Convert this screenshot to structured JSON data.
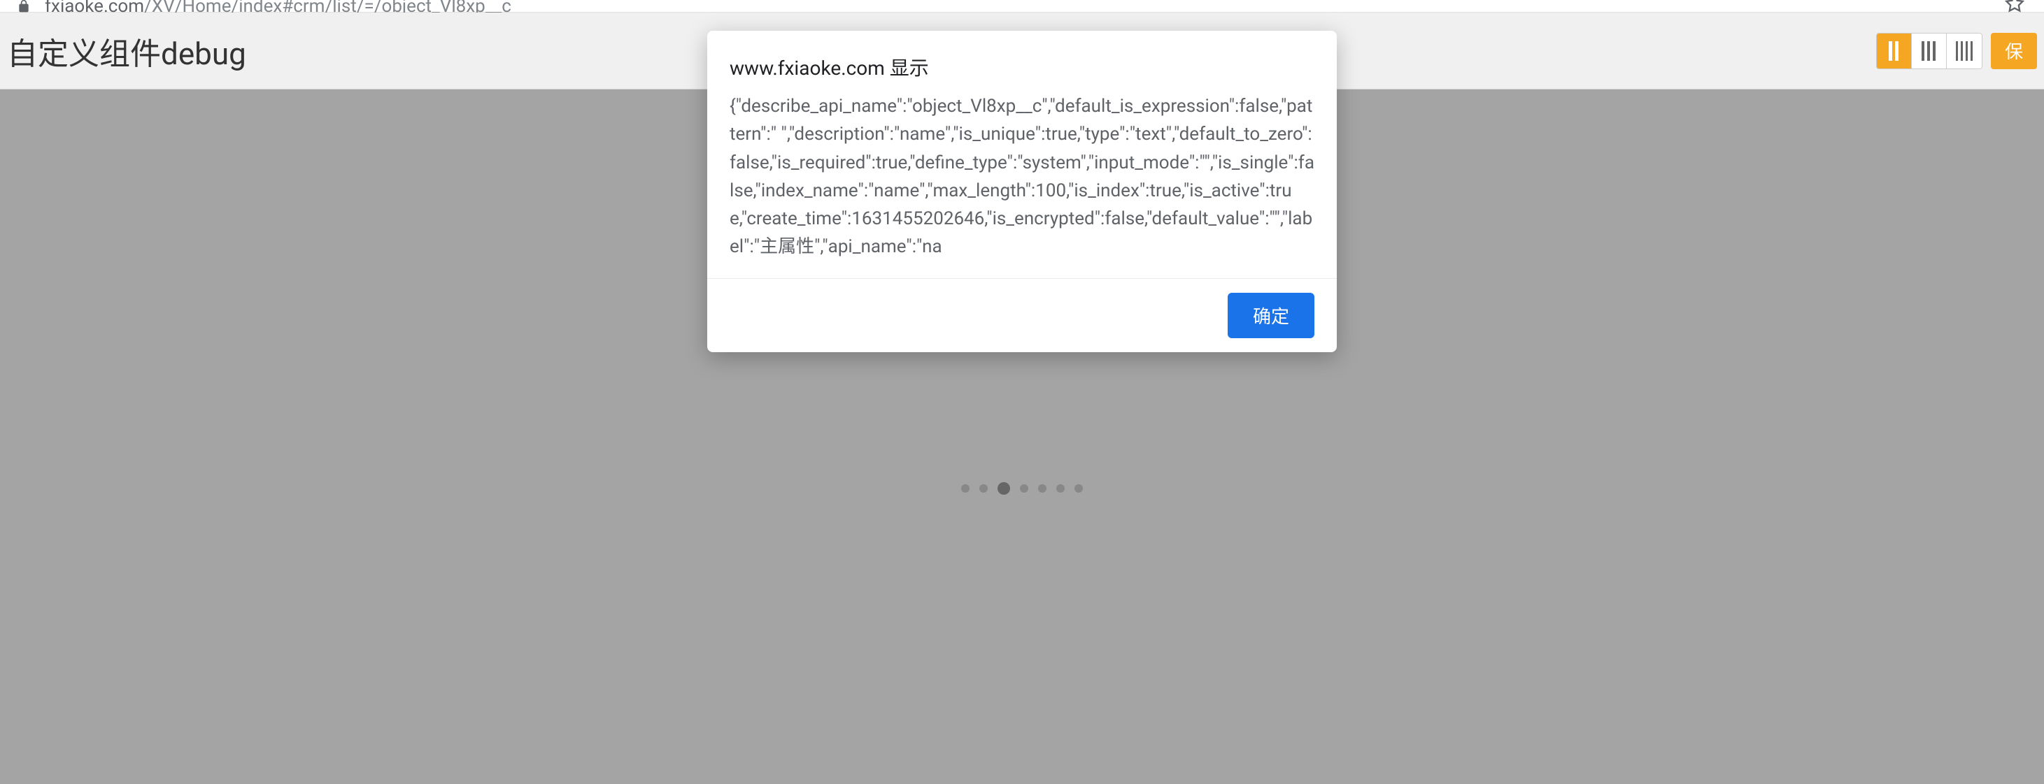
{
  "browser": {
    "url_domain": "fxiaoke.com",
    "url_path": "/XV/Home/index#crm/list/=/object_Vl8xp__c"
  },
  "header": {
    "title": "自定义组件debug",
    "save_label": "保"
  },
  "alert": {
    "title": "www.fxiaoke.com 显示",
    "body": "{\"describe_api_name\":\"object_Vl8xp__c\",\"default_is_expression\":false,\"pattern\":\" \",\"description\":\"name\",\"is_unique\":true,\"type\":\"text\",\"default_to_zero\":false,\"is_required\":true,\"define_type\":\"system\",\"input_mode\":\"\",\"is_single\":false,\"index_name\":\"name\",\"max_length\":100,\"is_index\":true,\"is_active\":true,\"create_time\":1631455202646,\"is_encrypted\":false,\"default_value\":\"\",\"label\":\"主属性\",\"api_name\":\"na",
    "ok_label": "确定"
  }
}
